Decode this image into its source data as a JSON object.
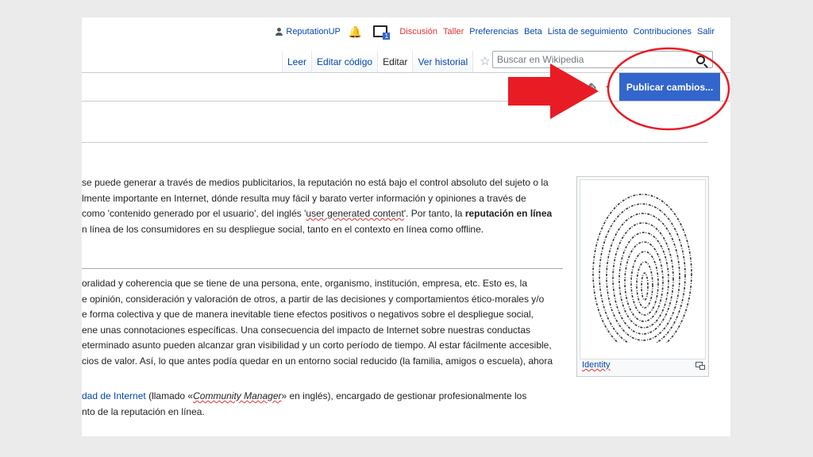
{
  "personal": {
    "username": "ReputationUP",
    "notice_badge": "1",
    "links": [
      {
        "label": "Discusión",
        "color": "#d33"
      },
      {
        "label": "Taller",
        "color": "#d33"
      },
      {
        "label": "Preferencias",
        "color": "#0645ad"
      },
      {
        "label": "Beta",
        "color": "#0645ad"
      },
      {
        "label": "Lista de seguimiento",
        "color": "#0645ad"
      },
      {
        "label": "Contribuciones",
        "color": "#0645ad"
      },
      {
        "label": "Salir",
        "color": "#0645ad"
      }
    ]
  },
  "tabs": [
    {
      "label": "Leer",
      "selected": false
    },
    {
      "label": "Editar código",
      "selected": false
    },
    {
      "label": "Editar",
      "selected": true
    },
    {
      "label": "Ver historial",
      "selected": false
    }
  ],
  "search": {
    "placeholder": "Buscar en Wikipedia",
    "value": ""
  },
  "toolbar": {
    "publish_label": "Publicar cambios..."
  },
  "content": {
    "para1": {
      "l1": "se puede generar a través de medios publicitarios, la reputación no está bajo el control absoluto del sujeto o la",
      "l2": "lmente importante en Internet, dónde resulta muy fácil y barato verter información y opiniones a través de",
      "l3a": "como 'contenido generado por el usuario', del inglés '",
      "l3b": "user generated content",
      "l3c": "'. Por tanto, la ",
      "l3d": "reputación en línea",
      "l4": "n línea de los consumidores en su despliegue social, tanto en el contexto en línea como offline."
    },
    "para2": [
      "oralidad y coherencia que se tiene de una persona, ente, organismo, institución, empresa, etc. Esto es, la",
      "e opinión, consideración y valoración de otros, a partir de las decisiones y comportamientos ético-morales y/o",
      "e forma colectiva y que de manera inevitable tiene efectos positivos o negativos sobre el despliegue social,",
      "ene unas connotaciones específicas. Una consecuencia del impacto de Internet sobre nuestras conductas",
      "eterminado asunto pueden alcanzar gran visibilidad y un corto período de tiempo. Al estar fácilmente accesible,",
      "cios de valor. Así, lo que antes podía quedar en un entorno social reducido (la familia, amigos o escuela), ahora"
    ],
    "para3": {
      "link": "dad de Internet",
      "t1": " (llamado «",
      "italic": "Community Manager",
      "t2": "» en inglés), encargado de gestionar profesionalmente los",
      "l2": "nto de la reputación en línea."
    }
  },
  "figure": {
    "caption": "Identity"
  },
  "colors": {
    "accent": "#3366cc",
    "annotation": "#e81c24",
    "link": "#0645ad",
    "redlink": "#d33"
  }
}
